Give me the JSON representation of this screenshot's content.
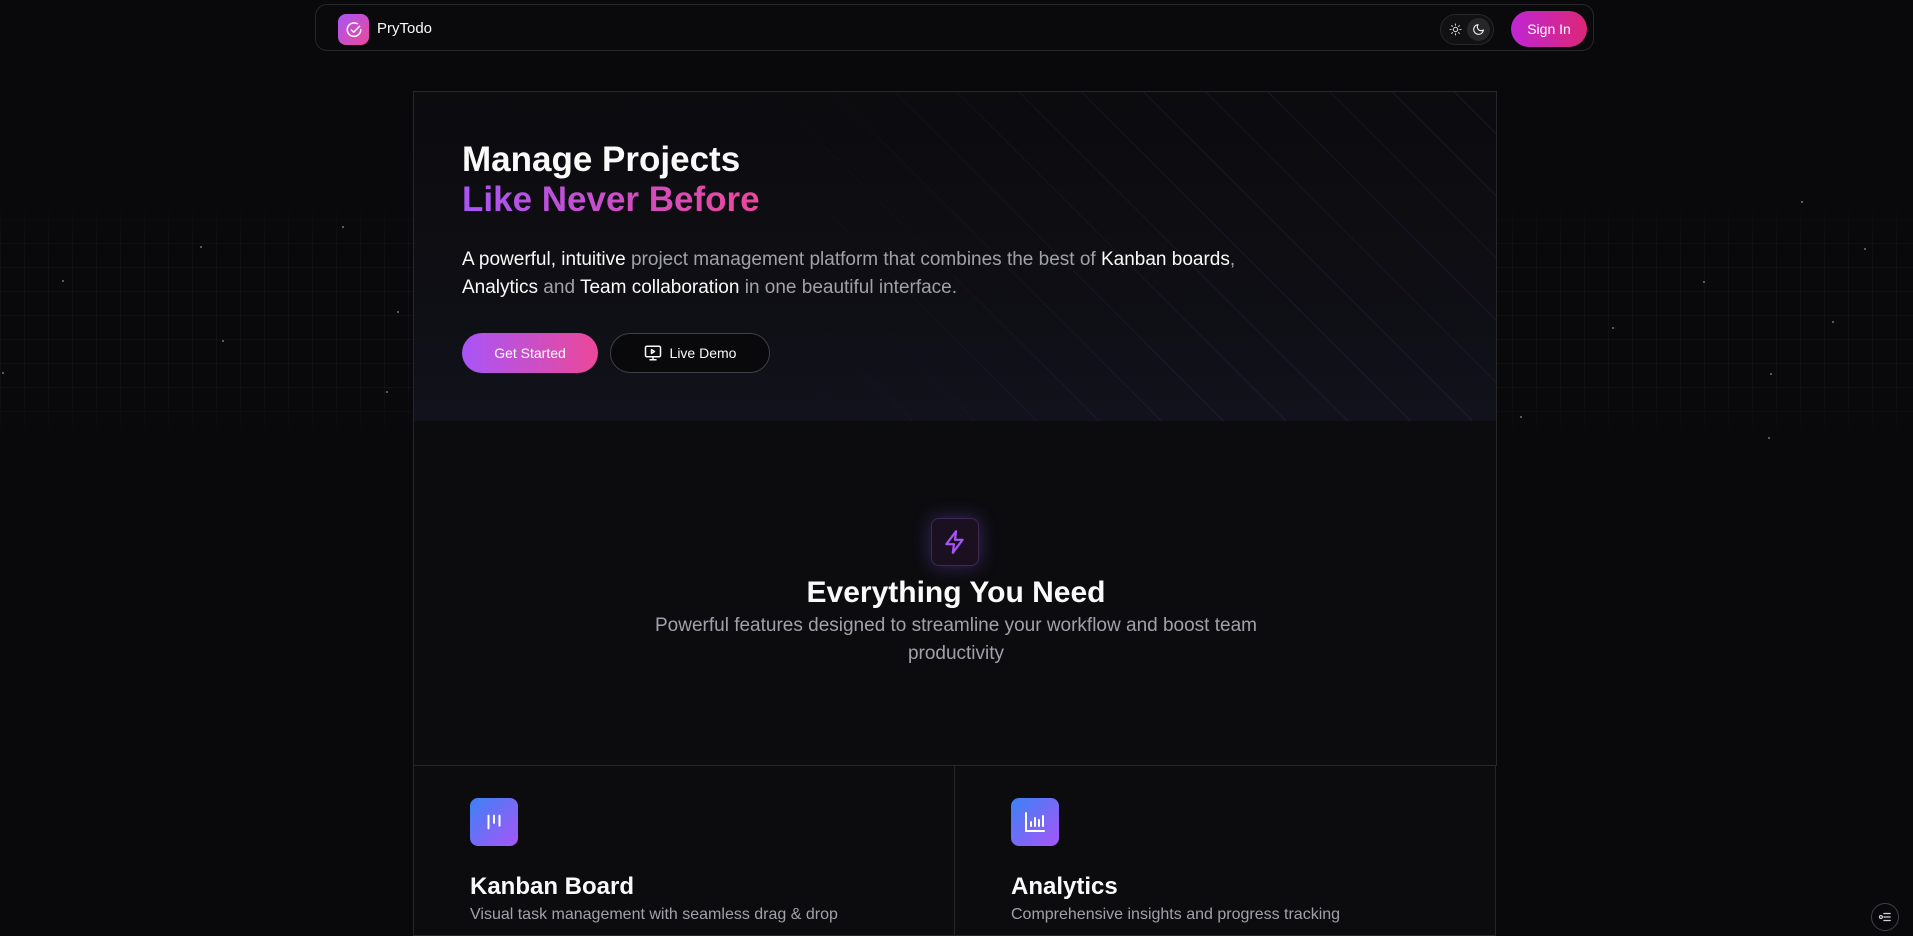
{
  "navbar": {
    "brand": "PryTodo",
    "sign_in": "Sign In"
  },
  "hero": {
    "title_line1": "Manage Projects",
    "title_line2": "Like Never Before",
    "desc": {
      "p1": "A powerful, intuitive",
      "p2": " project management platform that combines the best of ",
      "p3": "Kanban boards",
      "p4": ", ",
      "p5": "Analytics",
      "p6": " and ",
      "p7": "Team collaboration",
      "p8": " in one beautiful interface."
    },
    "get_started": "Get Started",
    "live_demo": "Live Demo"
  },
  "features": {
    "title": "Everything You Need",
    "subtitle": "Powerful features designed to streamline your workflow and boost team productivity",
    "cards": [
      {
        "title": "Kanban Board",
        "desc": "Visual task management with seamless drag & drop",
        "icon": "kanban-icon"
      },
      {
        "title": "Analytics",
        "desc": "Comprehensive insights and progress tracking",
        "icon": "bar-chart-icon"
      }
    ]
  },
  "colors": {
    "background": "#09090b",
    "accent_purple": "#a855f7",
    "accent_pink": "#ec4899",
    "accent_blue": "#3b82f6"
  }
}
